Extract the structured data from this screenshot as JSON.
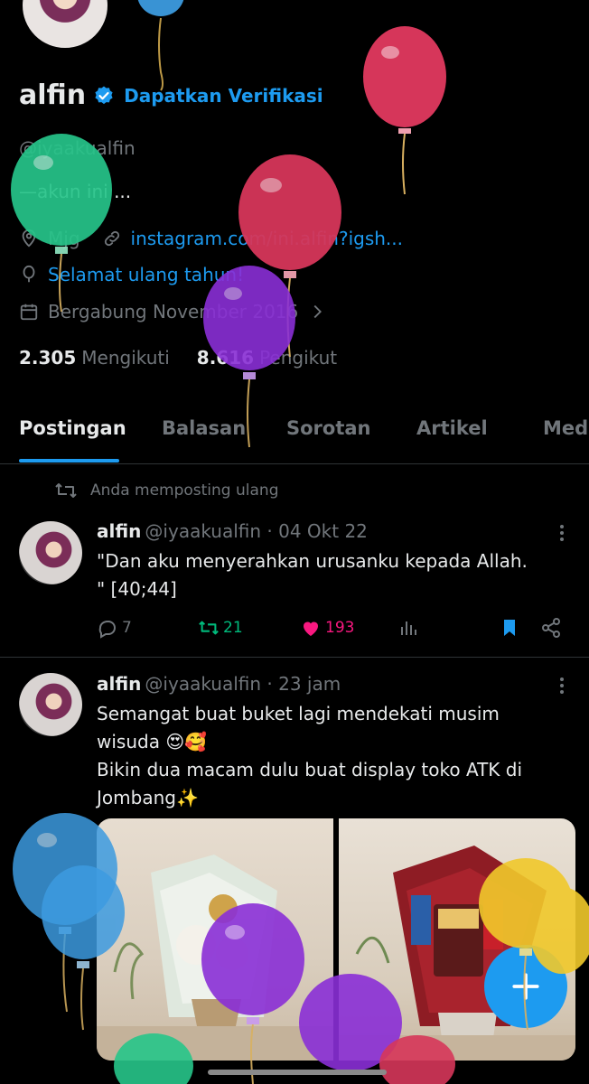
{
  "profile": {
    "name": "alfin",
    "get_verified": "Dapatkan Verifikasi",
    "handle": "@iyaakualfin",
    "bio": "—akun ini ...",
    "location": "Mjg",
    "website": "instagram.com/ini.alfin?igsh...",
    "birthday": "Selamat ulang tahun!",
    "joined": "Bergabung November 2016",
    "following_count": "2.305",
    "following_label": "Mengikuti",
    "followers_count": "8.616",
    "followers_label": "Pengikut"
  },
  "tabs": [
    "Postingan",
    "Balasan",
    "Sorotan",
    "Artikel",
    "Media"
  ],
  "repost_note": "Anda memposting ulang",
  "posts": [
    {
      "name": "alfin",
      "handle": "@iyaakualfin · 04 Okt 22",
      "text_line1": "\"Dan aku menyerahkan urusanku kepada Allah.",
      "text_line2": "\" [40;44]",
      "replies": "7",
      "reposts": "21",
      "likes": "193"
    },
    {
      "name": "alfin",
      "handle": "@iyaakualfin · 23 jam",
      "text_line1": "Semangat buat buket lagi mendekati musim",
      "text_line2": "wisuda 😍🥰",
      "text_line3": "Bikin dua macam dulu buat display toko ATK di",
      "text_line4": "Jombang✨"
    }
  ],
  "colors": {
    "accent": "#1d9bf0",
    "background": "#000000",
    "muted": "#71767b",
    "repost_green": "#00ba7c",
    "like_pink": "#f91880"
  },
  "icons": [
    "verified-icon",
    "location-icon",
    "link-icon",
    "balloon-icon",
    "calendar-icon",
    "chevron-right-icon",
    "repost-icon",
    "more-icon",
    "reply-icon",
    "heart-icon",
    "views-icon",
    "bookmark-icon",
    "share-icon",
    "plus-icon"
  ]
}
